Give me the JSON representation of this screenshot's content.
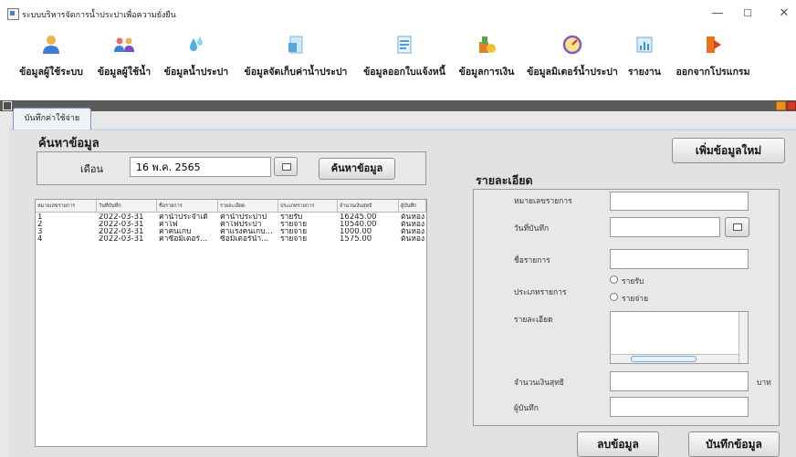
{
  "window": {
    "title": "ระบบบริหารจัดการน้ำประปาเพื่อความยั่งยืน",
    "minimize_glyph": "—",
    "maximize_glyph": "☐",
    "close_glyph": "✕"
  },
  "toolbar": {
    "items": [
      {
        "label": "ข้อมูลผู้ใช้ระบบ",
        "icon": "user-icon"
      },
      {
        "label": "ข้อมูลผู้ใช้น้ำ",
        "icon": "users-icon"
      },
      {
        "label": "ข้อมูลน้ำประปา",
        "icon": "water-drop-icon"
      },
      {
        "label": "ข้อมูลจัดเก็บค่าน้ำประปา",
        "icon": "document-icon"
      },
      {
        "label": "ข้อมูลออกใบแจ้งหนี้",
        "icon": "invoice-icon"
      },
      {
        "label": "ข้อมูลการเงิน",
        "icon": "finance-icon"
      },
      {
        "label": "ข้อมูลมิเตอร์น้ำประปา",
        "icon": "gauge-icon"
      },
      {
        "label": "รายงาน",
        "icon": "report-icon"
      },
      {
        "label": "ออกจากโปรแกรม",
        "icon": "exit-icon"
      }
    ]
  },
  "tab": {
    "label": "บันทึกค่าใช้จ่าย"
  },
  "search": {
    "title": "ค้นหาข้อมูล",
    "month_label": "เดือน",
    "date_value": "16 พ.ค. 2565",
    "button_label": "ค้นหาข้อมูล"
  },
  "table": {
    "columns": [
      "หมายเลขรายการ",
      "วันที่บันทึก",
      "ชื่อรายการ",
      "รายละเอียด",
      "ประเภทรายการ",
      "จำนวนเงินสุทธิ",
      "ผู้บันทึก"
    ],
    "rows": [
      [
        "1",
        "2022-03-31",
        "ค่าน้ำประจำเดื",
        "ค่าน้ำประปาป",
        "รายรับ",
        "16245.00",
        "ต้นหอง"
      ],
      [
        "2",
        "2022-03-31",
        "ค่าไฟ",
        "ค่าไฟประปา",
        "รายจ่าย",
        "10540.00",
        "ต้นหอง"
      ],
      [
        "3",
        "2022-03-31",
        "ค่าคนเก็บ",
        "ค่าแรงคนเก็บ...",
        "รายจ่าย",
        "1000.00",
        "ต้นหอง"
      ],
      [
        "4",
        "2022-03-31",
        "ค่าซื้อมิเตอร์...",
        "ซื้อมิเตอร์น้ำ...",
        "รายจ่าย",
        "1575.00",
        "ต้นหอง"
      ]
    ]
  },
  "detail": {
    "new_button": "เพิ่มข้อมูลใหม่",
    "title": "รายละเอียด",
    "labels": {
      "id": "หมายเลขรายการ",
      "date": "วันที่บันทึก",
      "name": "ชื่อรายการ",
      "type": "ประเภทรายการ",
      "description": "รายละเอียด",
      "amount": "จำนวนเงินสุทธิ",
      "recorder": "ผู้บันทึก"
    },
    "radio_income": "รายรับ",
    "radio_expense": "รายจ่าย",
    "unit": "บาท",
    "delete_button": "ลบข้อมูล",
    "save_button": "บันทึกข้อมูล"
  }
}
